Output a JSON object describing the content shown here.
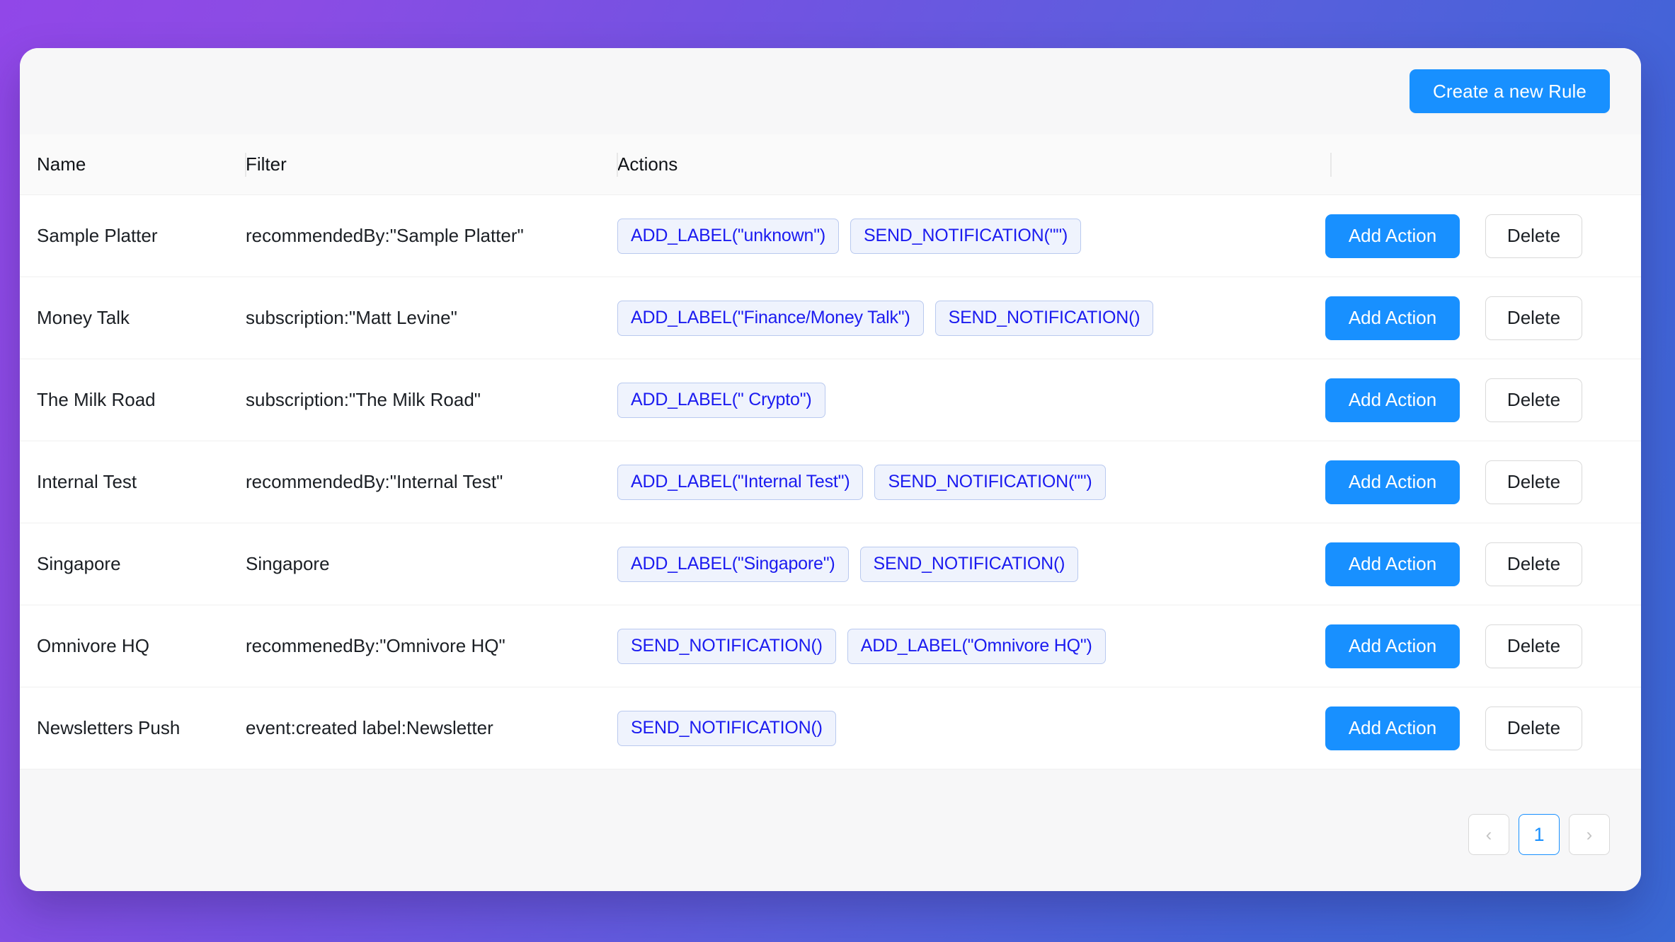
{
  "theme": {
    "gradient_start": "#9147e8",
    "gradient_end": "#3a68d4",
    "accent_blue": "#1890ff",
    "tag_text": "#1b1bf0",
    "tag_bg": "#eff3fd",
    "tag_border": "#b9c9ef",
    "card_bg": "#f7f7f8"
  },
  "toolbar": {
    "create_rule_label": "Create a new Rule"
  },
  "table": {
    "headers": {
      "name": "Name",
      "filter": "Filter",
      "actions": "Actions",
      "ops": ""
    },
    "ops_labels": {
      "add_action": "Add Action",
      "delete": "Delete"
    },
    "rows": [
      {
        "name": "Sample Platter",
        "filter": "recommendedBy:\"Sample Platter\"",
        "actions": [
          "ADD_LABEL(\"unknown\")",
          "SEND_NOTIFICATION(\"\")"
        ]
      },
      {
        "name": "Money Talk",
        "filter": "subscription:\"Matt Levine\"",
        "actions": [
          "ADD_LABEL(\"Finance/Money Talk\")",
          "SEND_NOTIFICATION()"
        ]
      },
      {
        "name": "The Milk Road",
        "filter": "subscription:\"The Milk Road\"",
        "actions": [
          "ADD_LABEL(\" Crypto\")"
        ]
      },
      {
        "name": "Internal Test",
        "filter": "recommendedBy:\"Internal Test\"",
        "actions": [
          "ADD_LABEL(\"Internal Test\")",
          "SEND_NOTIFICATION(\"\")"
        ]
      },
      {
        "name": "Singapore",
        "filter": "Singapore",
        "actions": [
          "ADD_LABEL(\"Singapore\")",
          "SEND_NOTIFICATION()"
        ]
      },
      {
        "name": "Omnivore HQ",
        "filter": "recommenedBy:\"Omnivore HQ\"",
        "actions": [
          "SEND_NOTIFICATION()",
          "ADD_LABEL(\"Omnivore HQ\")"
        ]
      },
      {
        "name": "Newsletters Push",
        "filter": "event:created label:Newsletter",
        "actions": [
          "SEND_NOTIFICATION()"
        ]
      }
    ]
  },
  "pagination": {
    "prev_label": "‹",
    "next_label": "›",
    "pages": [
      "1"
    ],
    "current_page": "1"
  }
}
